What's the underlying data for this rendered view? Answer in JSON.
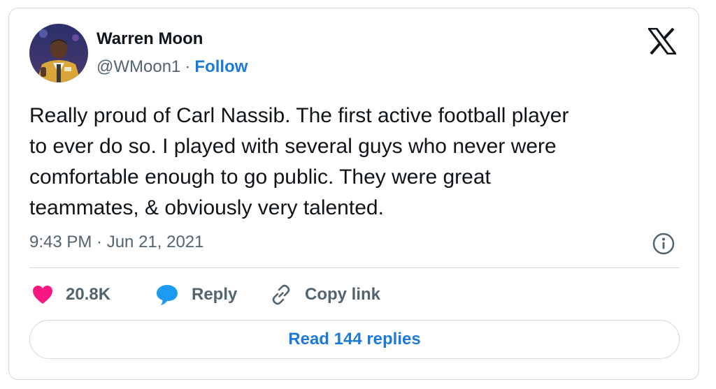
{
  "author": {
    "name": "Warren Moon",
    "handle": "@WMoon1",
    "separator": "·",
    "follow_label": "Follow"
  },
  "tweet": {
    "lines": [
      "Really proud of Carl Nassib. The first  active football player",
      "to ever do so. I played with several guys who never were",
      "comfortable enough to go public. They were great",
      "teammates, & obviously very talented."
    ],
    "timestamp": "9:43 PM · Jun 21, 2021"
  },
  "actions": {
    "likes_count": "20.8K",
    "reply_label": "Reply",
    "copy_link_label": "Copy link"
  },
  "read_replies_label": "Read 144 replies",
  "icons": {
    "brand": "x-logo-icon",
    "info": "info-icon",
    "like": "heart-icon",
    "reply": "speech-bubble-icon",
    "copy": "link-icon"
  },
  "colors": {
    "accent": "#1d79d6",
    "like": "#f91880",
    "reply_icon": "#1d9bf0",
    "muted": "#536471",
    "border": "#cfd9de"
  }
}
